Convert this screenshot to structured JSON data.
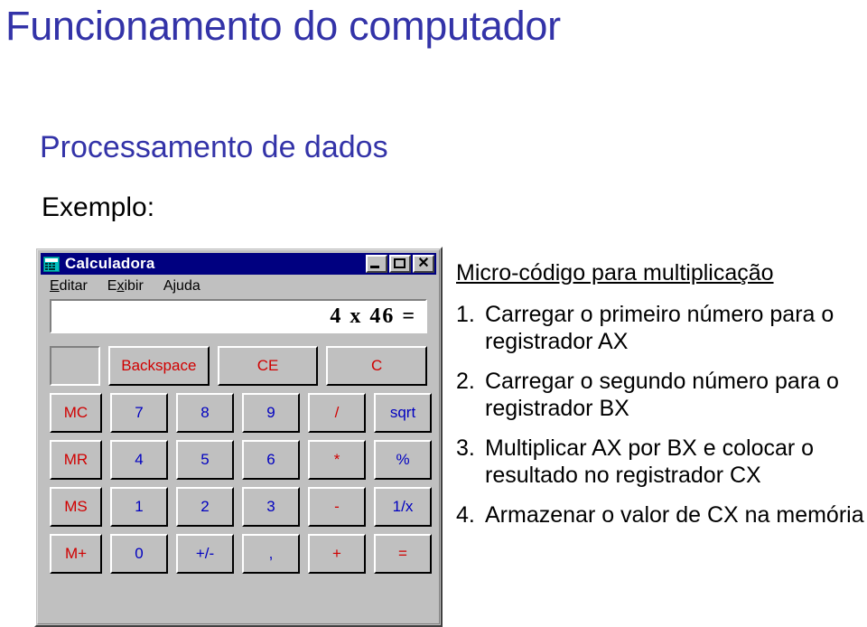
{
  "slide": {
    "title": "Funcionamento do computador",
    "subtitle": "Processamento de dados",
    "example_label": "Exemplo:",
    "title_color": "#3333a8",
    "subtitle_color": "#3333a8"
  },
  "microcode": {
    "heading": "Micro-código para multiplicação",
    "steps": [
      {
        "num": "1.",
        "text": "Carregar o primeiro número para o registrador AX"
      },
      {
        "num": "2.",
        "text": "Carregar o segundo número para o registrador BX"
      },
      {
        "num": "3.",
        "text": "Multiplicar AX por BX e colocar o resultado no registrador CX"
      },
      {
        "num": "4.",
        "text": "Armazenar o valor de CX na memória"
      }
    ]
  },
  "calculator": {
    "title": "Calculadora",
    "icon": "calculator-icon",
    "titlebar_color": "#000080",
    "window_buttons": [
      {
        "name": "minimize",
        "label": "_"
      },
      {
        "name": "maximize",
        "label": "□"
      },
      {
        "name": "close",
        "label": "✕"
      }
    ],
    "close_glyph": "✕",
    "menu": [
      {
        "pre": "",
        "mnemonic": "E",
        "post": "ditar"
      },
      {
        "pre": "E",
        "mnemonic": "x",
        "post": "ibir"
      },
      {
        "pre": "A",
        "mnemonic": "j",
        "post": "uda"
      }
    ],
    "display_value": "4 x 46 =",
    "memory_indicator": "",
    "keys": {
      "row_commands": [
        {
          "label": "Backspace",
          "kind": "cmd"
        },
        {
          "label": "CE",
          "kind": "cmd"
        },
        {
          "label": "C",
          "kind": "cmd"
        }
      ],
      "rows": [
        {
          "memory": {
            "label": "MC",
            "kind": "mem"
          },
          "digits": [
            {
              "label": "7",
              "kind": "num"
            },
            {
              "label": "8",
              "kind": "num"
            },
            {
              "label": "9",
              "kind": "num"
            }
          ],
          "operator": {
            "label": "/",
            "kind": "op"
          },
          "function": {
            "label": "sqrt",
            "kind": "fn"
          }
        },
        {
          "memory": {
            "label": "MR",
            "kind": "mem"
          },
          "digits": [
            {
              "label": "4",
              "kind": "num"
            },
            {
              "label": "5",
              "kind": "num"
            },
            {
              "label": "6",
              "kind": "num"
            }
          ],
          "operator": {
            "label": "*",
            "kind": "op"
          },
          "function": {
            "label": "%",
            "kind": "fn"
          }
        },
        {
          "memory": {
            "label": "MS",
            "kind": "mem"
          },
          "digits": [
            {
              "label": "1",
              "kind": "num"
            },
            {
              "label": "2",
              "kind": "num"
            },
            {
              "label": "3",
              "kind": "num"
            }
          ],
          "operator": {
            "label": "-",
            "kind": "op"
          },
          "function": {
            "label": "1/x",
            "kind": "fn"
          }
        },
        {
          "memory": {
            "label": "M+",
            "kind": "mem"
          },
          "digits": [
            {
              "label": "0",
              "kind": "num"
            },
            {
              "label": "+/-",
              "kind": "num"
            },
            {
              "label": ",",
              "kind": "num"
            }
          ],
          "operator": {
            "label": "+",
            "kind": "op"
          },
          "function": {
            "label": "=",
            "kind": "op"
          }
        }
      ]
    }
  }
}
